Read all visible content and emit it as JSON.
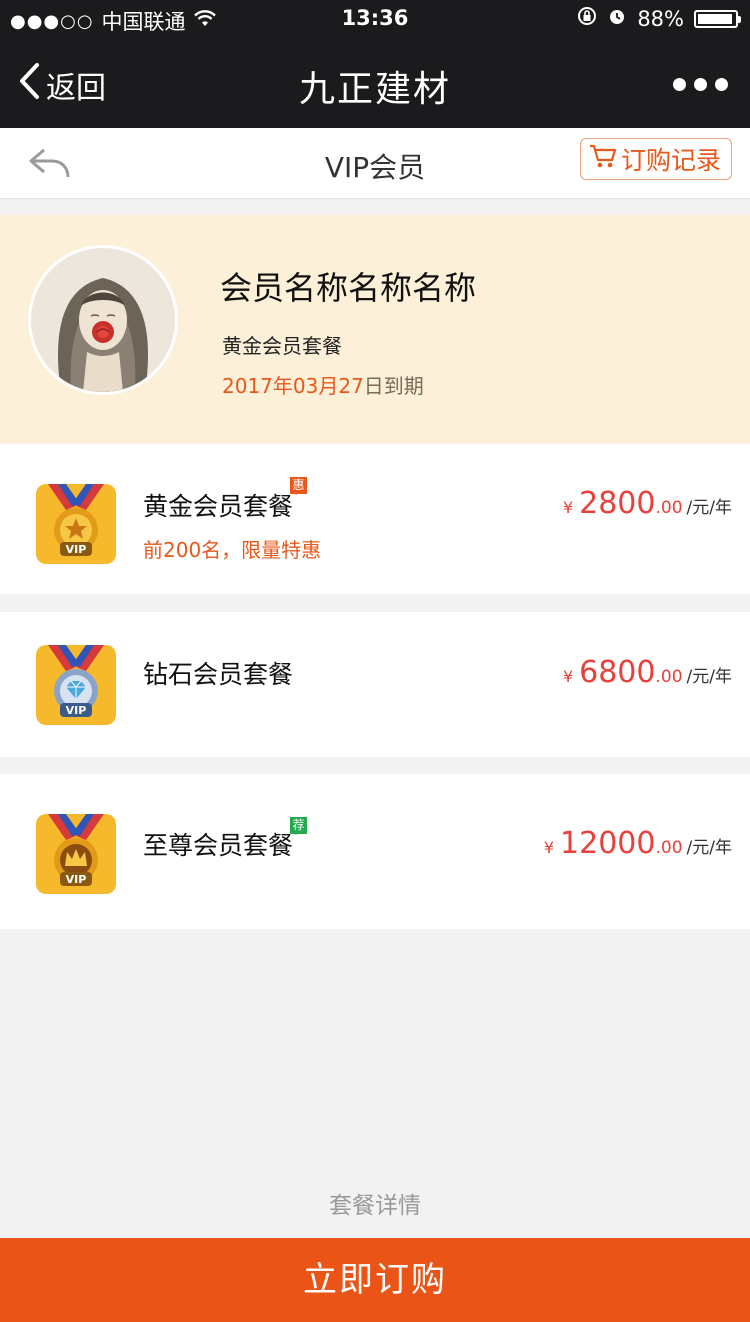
{
  "status_bar": {
    "carrier": "中国联通",
    "signal": "●●●○○",
    "time": "13:36",
    "battery": "88%"
  },
  "nav": {
    "back_label": "返回",
    "title": "九正建材"
  },
  "subheader": {
    "title": "VIP会员",
    "order_record_label": "订购记录"
  },
  "profile": {
    "name": "会员名称名称名称",
    "plan": "黄金会员套餐",
    "expire_date": "2017年03月27",
    "expire_suffix": "日到期"
  },
  "packages": [
    {
      "name": "黄金会员套餐",
      "badge": "惠",
      "promo": "前200名，限量特惠",
      "currency": "¥",
      "price_int": "2800",
      "price_dec": ".00",
      "unit": "/元/年"
    },
    {
      "name": "钻石会员套餐",
      "currency": "¥",
      "price_int": "6800",
      "price_dec": ".00",
      "unit": "/元/年"
    },
    {
      "name": "至尊会员套餐",
      "badge": "荐",
      "currency": "¥",
      "price_int": "12000",
      "price_dec": ".00",
      "unit": "/元/年"
    }
  ],
  "details_label": "套餐详情",
  "buy_label": "立即订购",
  "colors": {
    "accent": "#ea5517",
    "price": "#e8403a",
    "profile_bg": "#fdf0d8",
    "badge_green": "#23a94e"
  }
}
